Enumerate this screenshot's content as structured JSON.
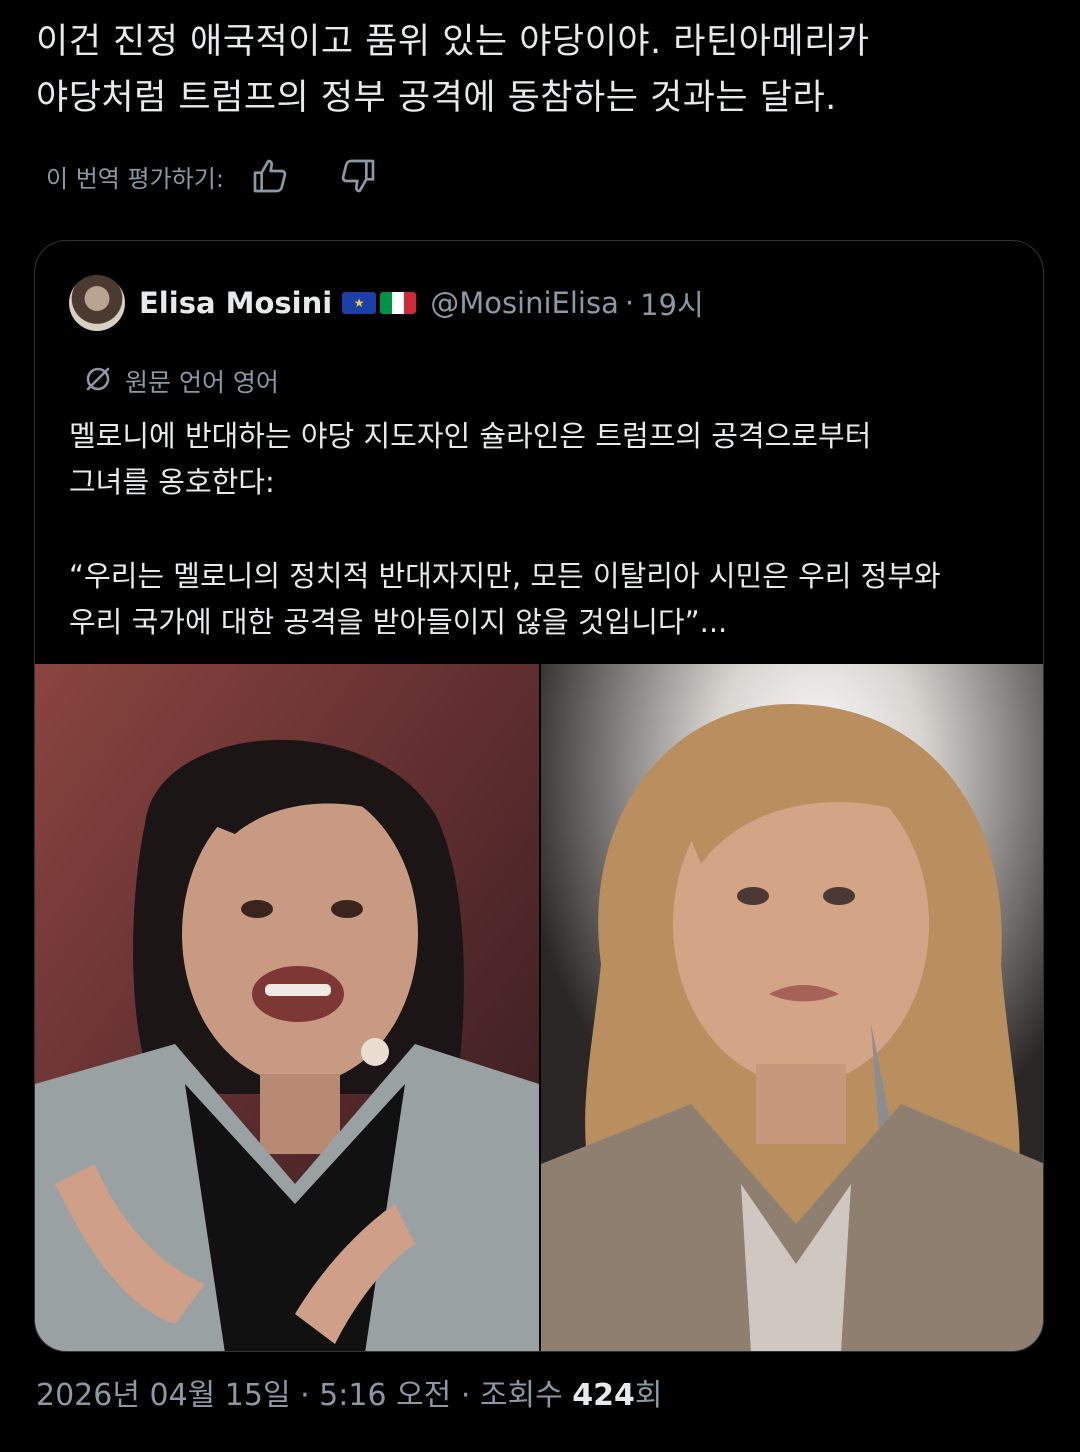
{
  "tweet": {
    "lines": [
      "이건 진정 애국적이고 품위 있는 야당이야. 라틴아메리카",
      "야당처럼 트럼프의 정부 공격에 동참하는 것과는 달라."
    ]
  },
  "translation_rating": {
    "label": "이 번역 평가하기:",
    "icons": [
      "thumbs-up-icon",
      "thumbs-down-icon"
    ]
  },
  "quote": {
    "author_name": "Elisa Mosini",
    "flags": [
      "eu-flag",
      "italy-flag"
    ],
    "handle": "@MosiniElisa",
    "separator": "·",
    "time": "19시",
    "original_language": "원문 언어 영어",
    "body": {
      "line1": "멜로니에 반대하는 야당 지도자인 슐라인은 트럼프의 공격으로부터",
      "line2": "그녀를 옹호한다:",
      "line3": "“우리는 멜로니의 정치적 반대자지만, 모든 이탈리아 시민은 우리 정부와",
      "line4": "우리 국가에 대한 공격을 받아들이지 않을 것입니다”..."
    }
  },
  "meta": {
    "date_time": "2026년 04월 15일 · 5:16 오전 · 조회수 ",
    "views": "424",
    "views_suffix": "회"
  },
  "colors": {
    "background": "#000000",
    "text": "#e7e9ea",
    "secondary": "#8b98a5",
    "border": "#2f3336"
  }
}
